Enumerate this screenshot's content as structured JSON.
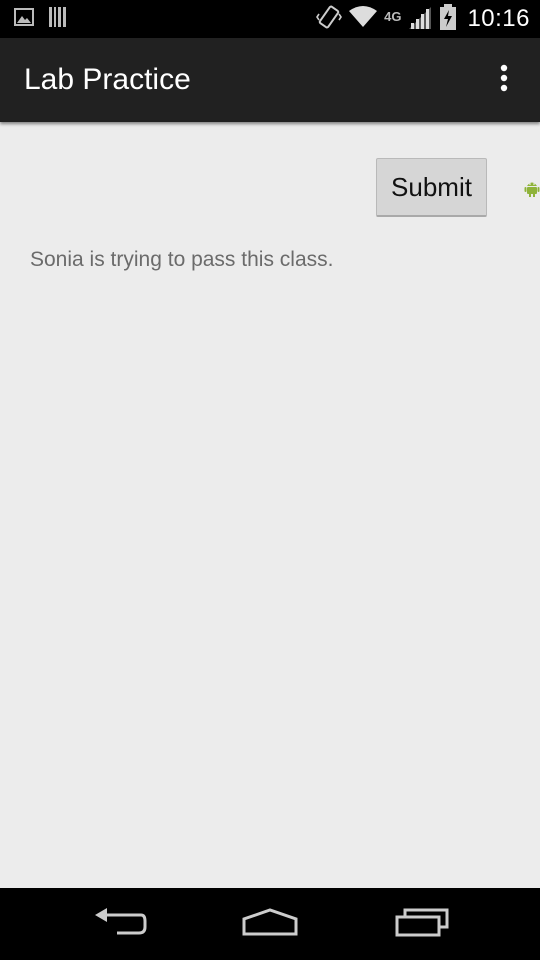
{
  "status_bar": {
    "time": "10:16",
    "network_type": "4G",
    "icons": [
      "image-notification-icon",
      "barcode-notification-icon",
      "vibrate-icon",
      "wifi-icon",
      "signal-icon",
      "battery-charging-icon"
    ]
  },
  "action_bar": {
    "title": "Lab Practice",
    "overflow_icon": "overflow-menu-icon",
    "background": "#212121"
  },
  "content": {
    "submit_label": "Submit",
    "message": "Sonia is trying to pass this class.",
    "side_icon": "android-icon",
    "background": "#ececec"
  },
  "nav_bar": {
    "icons": [
      "back-icon",
      "home-icon",
      "recents-icon"
    ]
  }
}
